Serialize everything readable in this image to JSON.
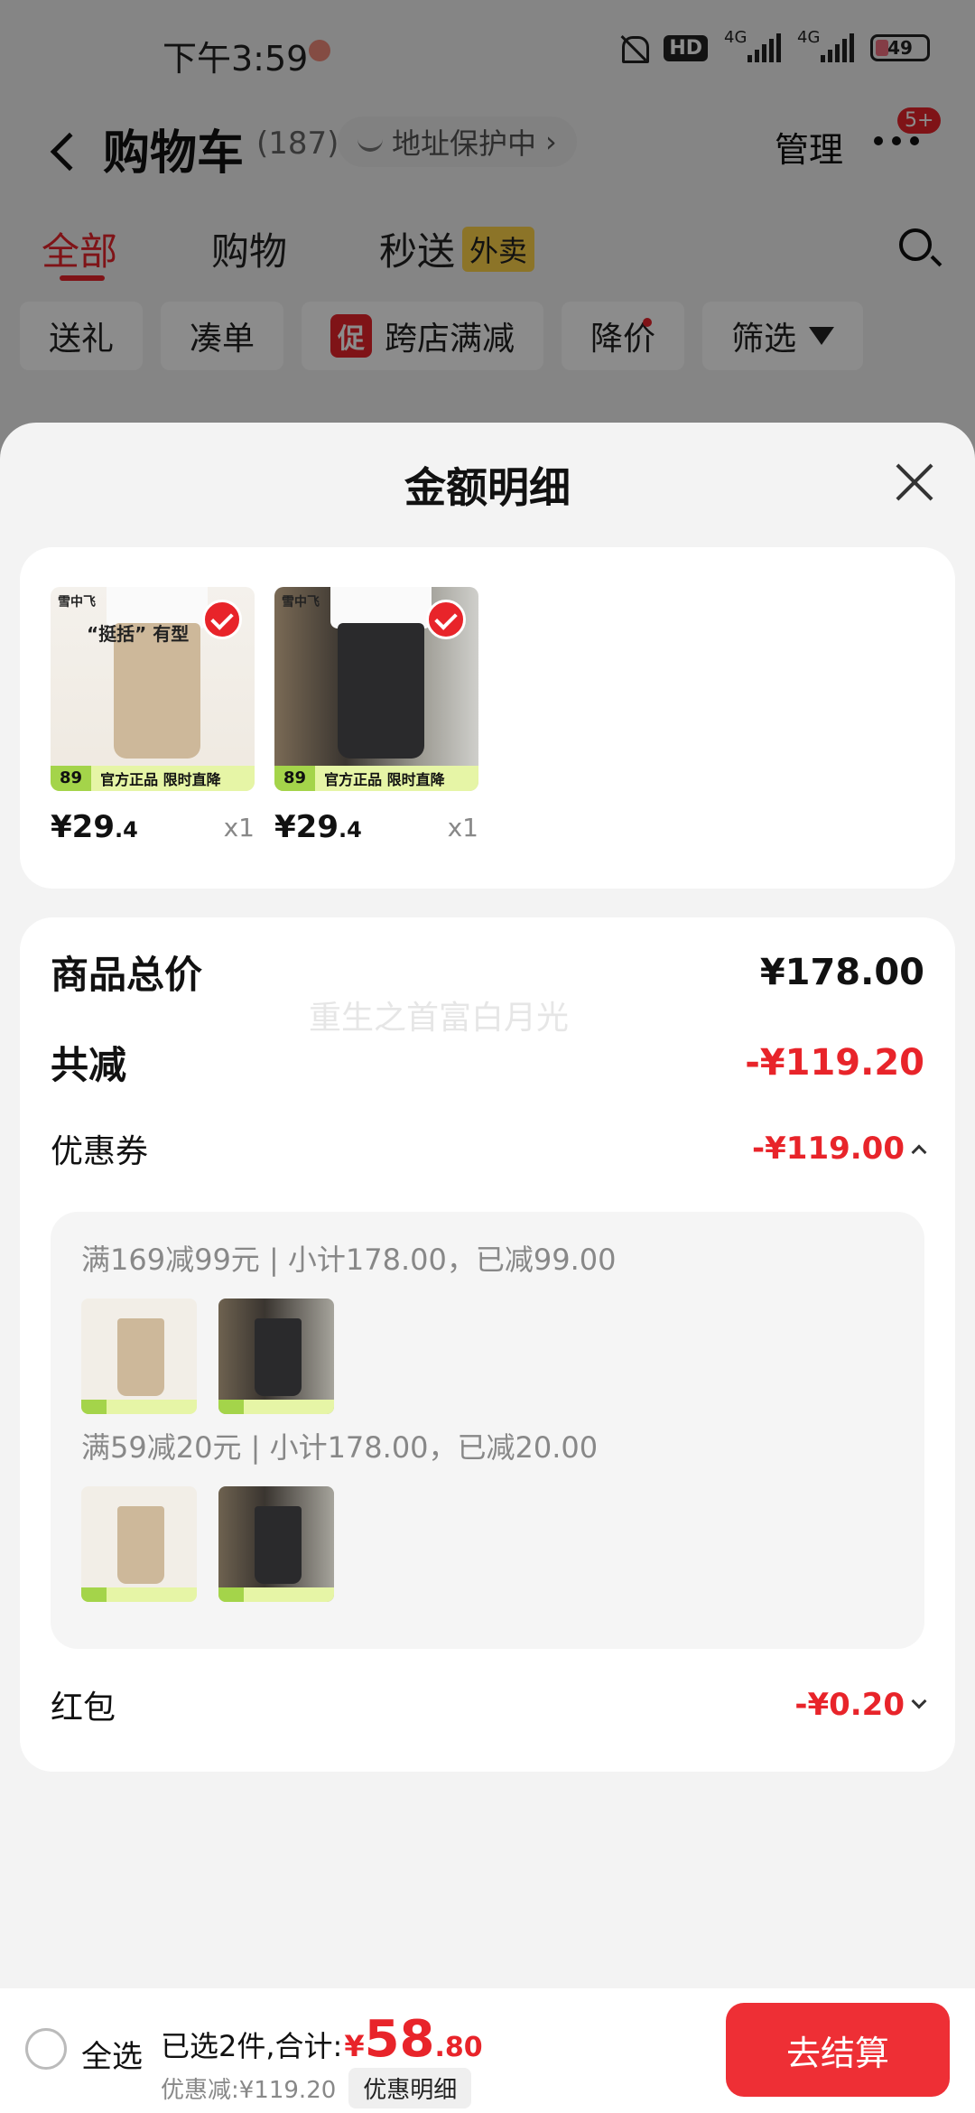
{
  "status_bar": {
    "time": "下午3:59",
    "hd": "HD",
    "network_1": "4G",
    "network_2": "4G",
    "battery": "49"
  },
  "nav": {
    "title": "购物车",
    "count": "(187)",
    "address_protect": "地址保护中",
    "manage": "管理",
    "badge": "5+"
  },
  "tabs": [
    {
      "label": "全部"
    },
    {
      "label": "购物"
    },
    {
      "label": "秒送",
      "tag": "外卖"
    }
  ],
  "filters": [
    {
      "label": "送礼"
    },
    {
      "label": "凑单"
    },
    {
      "label": "跨店满减",
      "tag": "促"
    },
    {
      "label": "降价"
    },
    {
      "label": "筛选"
    }
  ],
  "sheet": {
    "title": "金额明细",
    "items": [
      {
        "brand": "雪中飞",
        "slogan": "“挺括” 有型",
        "tag_num": "89",
        "tag_text": "官方正品 限时直降",
        "price_main": "¥29",
        "price_decimal": ".4",
        "qty": "x1"
      },
      {
        "brand": "雪中飞",
        "slogan": "",
        "tag_num": "89",
        "tag_text": "官方正品 限时直降",
        "price_main": "¥29",
        "price_decimal": ".4",
        "qty": "x1"
      }
    ],
    "total_label": "商品总价",
    "total_value": "¥178.00",
    "watermark": "重生之首富白月光",
    "reduce_label": "共减",
    "reduce_value": "-¥119.20",
    "coupon_label": "优惠券",
    "coupon_value": "-¥119.00",
    "coupons": [
      {
        "text": "满169减99元 | 小计178.00，已减99.00"
      },
      {
        "text": "满59减20元 | 小计178.00，已减20.00"
      }
    ],
    "redpacket_label": "红包",
    "redpacket_value": "-¥0.20"
  },
  "bottom": {
    "select_all": "全选",
    "selected": "已选2件,合计:",
    "currency": "¥",
    "amount_int": "58",
    "amount_dec": ".80",
    "discount": "优惠减:¥119.20",
    "detail_chip": "优惠明细",
    "checkout": "去结算"
  },
  "colors": {
    "accent": "#e8242a",
    "checkout_button": "#ee2f35",
    "promo_yellow": "#ffd34a",
    "tag_green": "#a4d44a"
  }
}
